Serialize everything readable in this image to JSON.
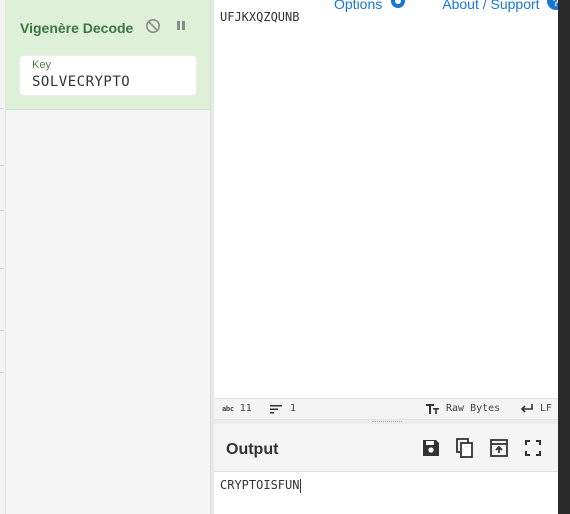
{
  "recipe": {
    "operation_title": "Vigenère Decode",
    "disable_icon": "disable-icon",
    "pause_icon": "pause-icon",
    "key_label": "Key",
    "key_value": "SOLVECRYPTO"
  },
  "top_links": {
    "options_label": "Options",
    "about_label": "About / Support"
  },
  "input": {
    "text": "UFJKXQZQUNB"
  },
  "status_bar": {
    "length_icon": "abc",
    "length_value": "11",
    "lines_value": "1",
    "encoding_label": "Raw Bytes",
    "eol_label": "LF"
  },
  "output": {
    "title": "Output",
    "text": "CRYPTOISFUN"
  },
  "colors": {
    "op_bg": "#dff0d8",
    "op_title": "#3c763d",
    "link": "#1976d2"
  }
}
